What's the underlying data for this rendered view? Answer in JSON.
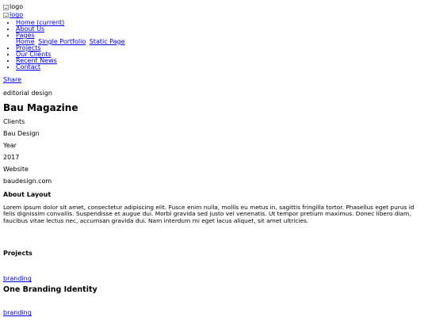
{
  "header": {
    "logo_alt_1": "logo",
    "logo_alt_2": "logo"
  },
  "nav": {
    "items": [
      {
        "label": "Home (current)"
      },
      {
        "label": "About Us"
      },
      {
        "label": "Pages"
      },
      {
        "label": "Projects"
      },
      {
        "label": "Our Clients"
      },
      {
        "label": "Recent News"
      },
      {
        "label": "Contact"
      }
    ],
    "pages_sub": [
      "Home",
      "Single Portfolio",
      "Static Page"
    ]
  },
  "share_label": "Share",
  "project": {
    "category": "editorial design",
    "title": "Bau Magazine",
    "meta": {
      "clients_label": "Clients",
      "clients_value": "Bau Design",
      "year_label": "Year",
      "year_value": "2017",
      "website_label": "Website",
      "website_value": "baudesign.com"
    },
    "about_heading": "About Layout",
    "about_text": "Lorem ipsum dolor sit amet, consectetur adipiscing elit. Fusce enim nulla, mollis eu metus in, sagittis fringilla tortor. Phasellus eget purus id felis dignissim convallis. Suspendisse et augue dui. Morbi gravida sed justo vel venenatis. Ut tempor pretium maximus. Donec libero diam, faucibus vitae lectus nec, accumsan gravida dui. Nam interdum mi eget lacus aliquet, sit amet ultricies."
  },
  "projects": {
    "heading": "Projects",
    "list": [
      {
        "category": "branding",
        "title": "One Branding Identity"
      },
      {
        "category": "branding"
      }
    ]
  }
}
